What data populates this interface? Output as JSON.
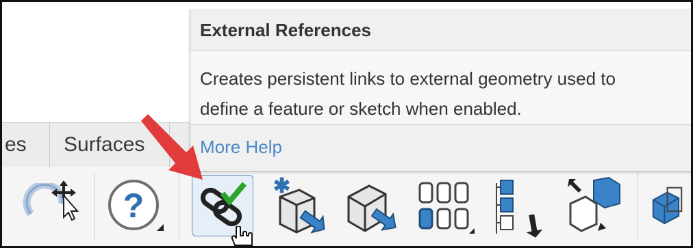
{
  "tabs": [
    {
      "label": "es"
    },
    {
      "label": "Surfaces"
    }
  ],
  "tooltip": {
    "title": "External References",
    "line1": "Creates persistent links to external geometry used to",
    "line2": "define a feature or sketch when enabled.",
    "link": "More Help"
  },
  "toolbar": {
    "tools": [
      {
        "icon": "redo-icon"
      },
      {
        "icon": "help-icon"
      },
      {
        "icon": "external-references-icon",
        "active": true
      },
      {
        "icon": "insert-feature-icon"
      },
      {
        "icon": "copy-body-icon"
      },
      {
        "icon": "pattern-table-icon"
      },
      {
        "icon": "feature-tree-icon"
      },
      {
        "icon": "move-face-icon"
      },
      {
        "icon": "3d-part-icon"
      }
    ]
  },
  "colors": {
    "annotation_arrow": "#e23b3b",
    "accent_blue": "#2f6fb3",
    "check_green": "#2da52d",
    "link_blue": "#4a89c8"
  }
}
